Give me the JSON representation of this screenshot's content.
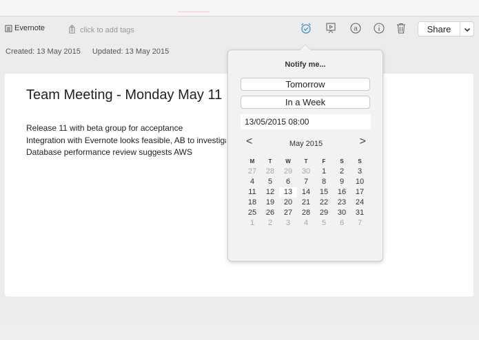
{
  "toolbar": {
    "notebook_label": "Evernote",
    "tags_placeholder": "click to add tags",
    "share_label": "Share"
  },
  "meta": {
    "created": "Created: 13 May 2015",
    "updated": "Updated: 13 May 2015"
  },
  "note": {
    "title": "Team Meeting - Monday May 11",
    "lines": [
      "Release 11 with beta group for acceptance",
      "Integration with Evernote looks feasible, AB to investigate",
      "Database performance review suggests AWS"
    ]
  },
  "reminder": {
    "title": "Notify me...",
    "options": [
      "Tomorrow",
      "In a Week"
    ],
    "datetime": "13/05/2015 08:00",
    "month_label": "May 2015",
    "prev_symbol": "<",
    "next_symbol": ">",
    "weekdays": [
      "M",
      "T",
      "W",
      "T",
      "F",
      "S",
      "S"
    ],
    "weeks": [
      [
        "27",
        "28",
        "29",
        "30",
        "1",
        "2",
        "3"
      ],
      [
        "4",
        "5",
        "6",
        "7",
        "8",
        "9",
        "10"
      ],
      [
        "11",
        "12",
        "13",
        "14",
        "15",
        "16",
        "17"
      ],
      [
        "18",
        "19",
        "20",
        "21",
        "22",
        "23",
        "24"
      ],
      [
        "25",
        "26",
        "27",
        "28",
        "29",
        "30",
        "31"
      ],
      [
        "1",
        "2",
        "3",
        "4",
        "5",
        "6",
        "7"
      ]
    ],
    "today": "13"
  },
  "icons": {
    "notebook": "notebook-icon",
    "tag": "tag-icon",
    "reminder": "alarm-clock-icon",
    "present": "presentation-icon",
    "at": "at-sign-icon",
    "info": "info-icon",
    "trash": "trash-icon",
    "chevron": "chevron-down-icon"
  },
  "colors": {
    "accent_blue": "#3a8fd8"
  }
}
